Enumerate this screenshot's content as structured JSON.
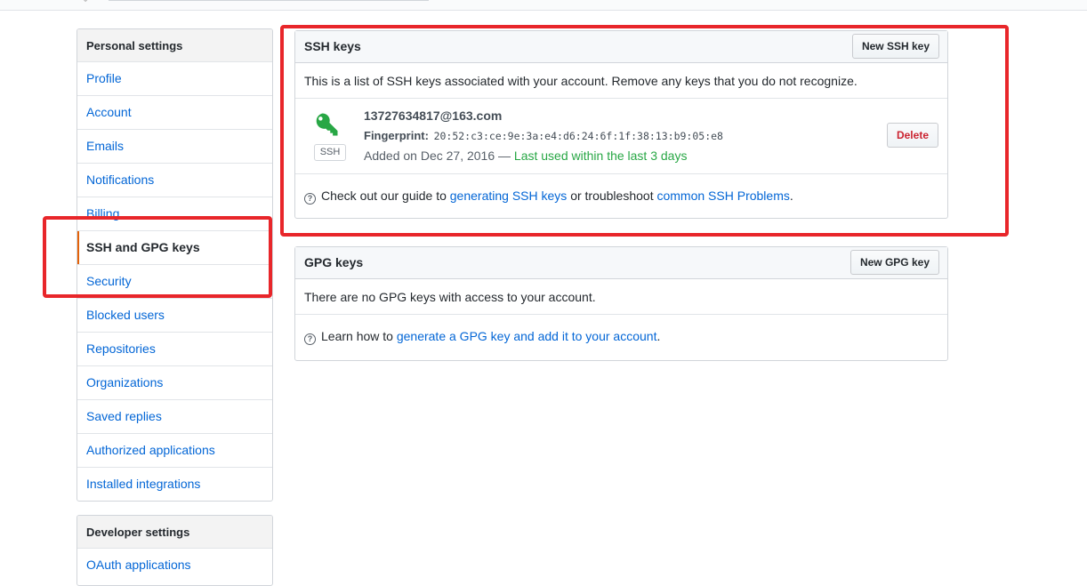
{
  "sidebar": {
    "heading": "Personal settings",
    "items": [
      {
        "label": "Profile"
      },
      {
        "label": "Account"
      },
      {
        "label": "Emails"
      },
      {
        "label": "Notifications"
      },
      {
        "label": "Billing"
      },
      {
        "label": "SSH and GPG keys",
        "selected": true
      },
      {
        "label": "Security"
      },
      {
        "label": "Blocked users"
      },
      {
        "label": "Repositories"
      },
      {
        "label": "Organizations"
      },
      {
        "label": "Saved replies"
      },
      {
        "label": "Authorized applications"
      },
      {
        "label": "Installed integrations"
      }
    ],
    "developer_heading": "Developer settings",
    "developer_items": [
      {
        "label": "OAuth applications"
      }
    ]
  },
  "ssh": {
    "title": "SSH keys",
    "new_button": "New SSH key",
    "description": "This is a list of SSH keys associated with your account. Remove any keys that you do not recognize.",
    "key": {
      "title": "13727634817@163.com",
      "fingerprint_label": "Fingerprint:",
      "fingerprint": "20:52:c3:ce:9e:3a:e4:d6:24:6f:1f:38:13:b9:05:e8",
      "badge": "SSH",
      "added": "Added on Dec 27, 2016 —",
      "last_used": "Last used within the last 3 days",
      "delete_button": "Delete",
      "icon": "key-icon",
      "icon_color": "#28a745"
    },
    "help": {
      "prefix": "Check out our guide to",
      "link1": "generating SSH keys",
      "middle": "or troubleshoot",
      "link2": "common SSH Problems",
      "suffix": "."
    }
  },
  "gpg": {
    "title": "GPG keys",
    "new_button": "New GPG key",
    "description": "There are no GPG keys with access to your account.",
    "help": {
      "prefix": "Learn how to",
      "link": "generate a GPG key and add it to your account",
      "suffix": "."
    }
  },
  "colors": {
    "link": "#0366d6",
    "selected_border": "#e36209",
    "annotation": "#e8262a",
    "danger": "#cb2431",
    "success": "#28a745"
  }
}
